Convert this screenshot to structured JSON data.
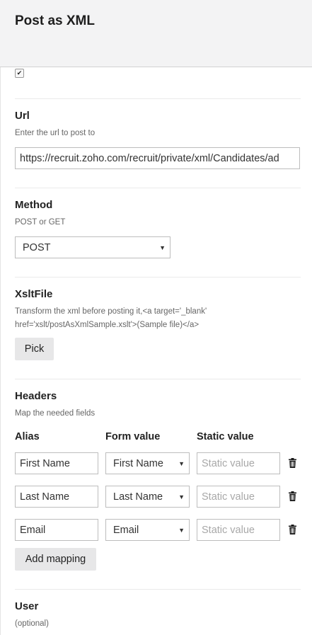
{
  "header": {
    "title": "Post as XML"
  },
  "enabled_checkbox": {
    "checked": true,
    "glyph": "✔"
  },
  "url": {
    "label": "Url",
    "help": "Enter the url to post to",
    "value": "https://recruit.zoho.com/recruit/private/xml/Candidates/ad"
  },
  "method": {
    "label": "Method",
    "help": "POST or GET",
    "value": "POST"
  },
  "xslt": {
    "label": "XsltFile",
    "help_line1": "Transform the xml before posting it,<a target='_blank'",
    "help_line2": "href='xslt/postAsXmlSample.xslt'>(Sample file)</a>",
    "pick_label": "Pick"
  },
  "headers": {
    "label": "Headers",
    "help": "Map the needed fields",
    "columns": [
      "Alias",
      "Form value",
      "Static value"
    ],
    "rows": [
      {
        "alias": "First Name",
        "form_value": "First Name",
        "static_placeholder": "Static value"
      },
      {
        "alias": "Last Name",
        "form_value": "Last Name",
        "static_placeholder": "Static value"
      },
      {
        "alias": "Email",
        "form_value": "Email",
        "static_placeholder": "Static value"
      }
    ],
    "add_label": "Add mapping"
  },
  "user": {
    "label": "User",
    "help": "(optional)"
  },
  "icons": {
    "delete": "trash-icon",
    "dropdown": "chevron-down-icon"
  }
}
